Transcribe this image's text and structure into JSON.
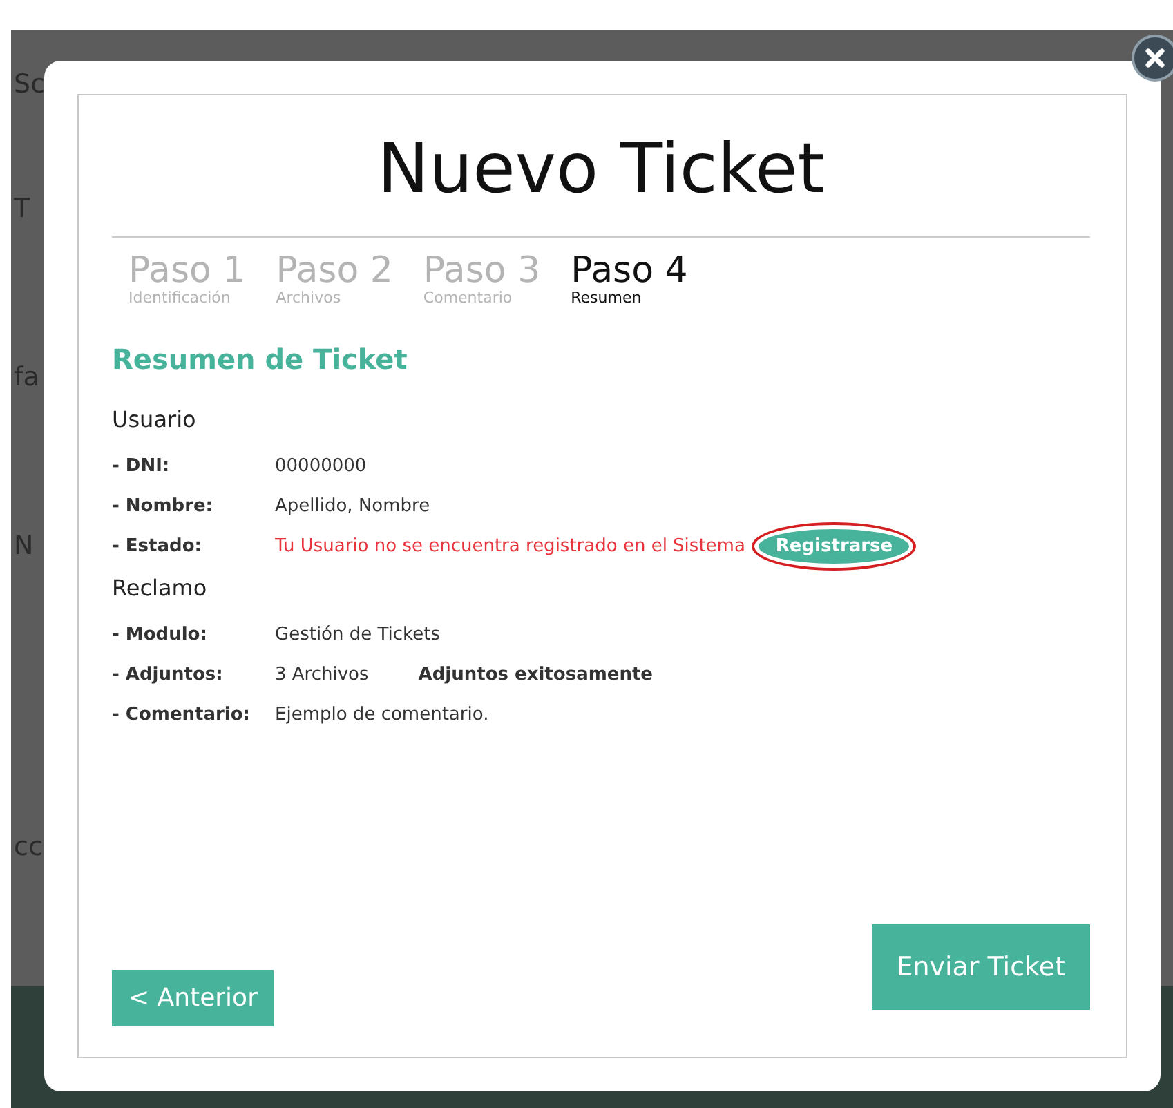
{
  "background_fragments": [
    "Sc",
    "T",
    "fa",
    "N",
    "cc"
  ],
  "modal": {
    "title": "Nuevo Ticket",
    "steps": [
      {
        "label": "Paso 1",
        "caption": "Identificación",
        "selected": false
      },
      {
        "label": "Paso 2",
        "caption": "Archivos",
        "selected": false
      },
      {
        "label": "Paso 3",
        "caption": "Comentario",
        "selected": false
      },
      {
        "label": "Paso 4",
        "caption": "Resumen",
        "selected": true
      }
    ],
    "heading": "Resumen de Ticket",
    "sections": [
      {
        "title": "Usuario",
        "rows": [
          {
            "label": "- DNI:",
            "value": "00000000"
          },
          {
            "label": "- Nombre:",
            "value": "Apellido, Nombre"
          },
          {
            "label": "- Estado:",
            "value": "Tu Usuario no se encuentra registrado en el Sistema",
            "kind": "error",
            "action": "Registrarse"
          }
        ]
      },
      {
        "title": "Reclamo",
        "rows": [
          {
            "label": "- Modulo:",
            "value": "Gestión de Tickets"
          },
          {
            "label": "- Adjuntos:",
            "value": "3 Archivos",
            "note": "Adjuntos exitosamente"
          },
          {
            "label": "- Comentario:",
            "value": "Ejemplo de comentario."
          }
        ]
      }
    ],
    "back_button": "< Anterior",
    "submit_button": "Enviar Ticket"
  }
}
